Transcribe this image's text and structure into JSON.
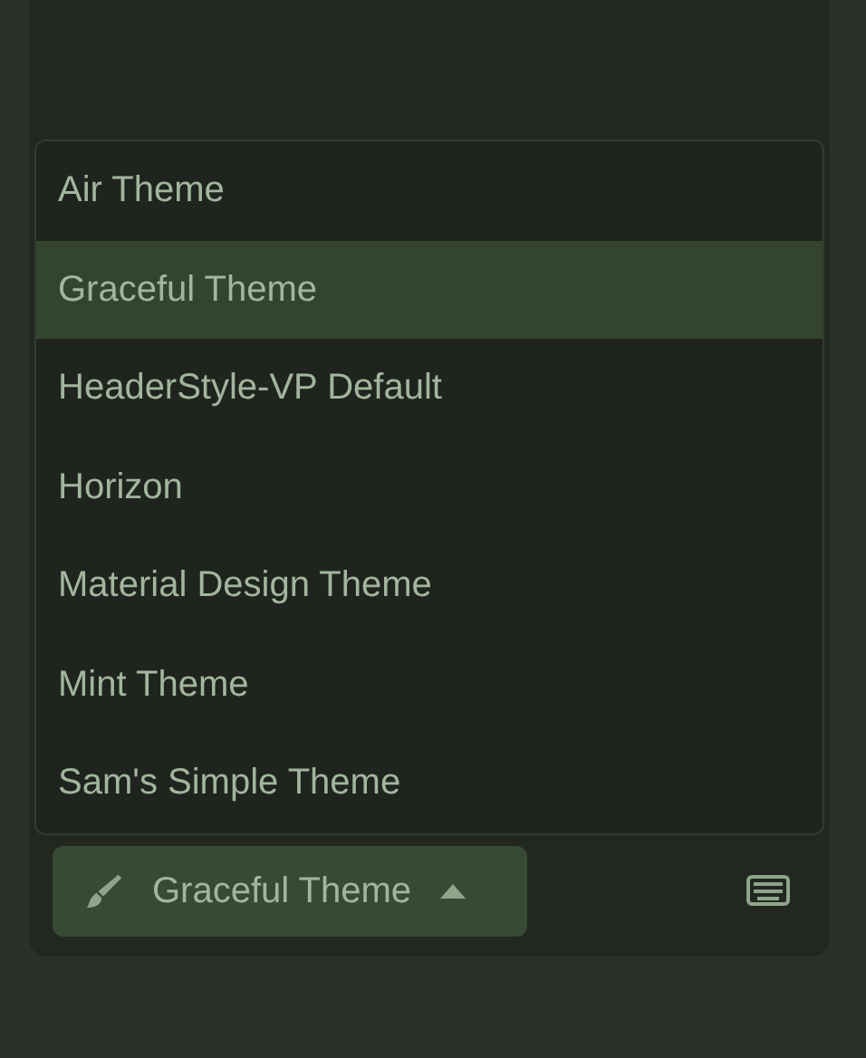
{
  "theme_menu": {
    "items": [
      {
        "label": "Air Theme",
        "selected": false
      },
      {
        "label": "Graceful Theme",
        "selected": true
      },
      {
        "label": "HeaderStyle-VP Default",
        "selected": false
      },
      {
        "label": "Horizon",
        "selected": false
      },
      {
        "label": "Material Design Theme",
        "selected": false
      },
      {
        "label": "Mint Theme",
        "selected": false
      },
      {
        "label": "Sam's Simple Theme",
        "selected": false
      }
    ]
  },
  "theme_button": {
    "label": "Graceful Theme",
    "expanded": true
  }
}
